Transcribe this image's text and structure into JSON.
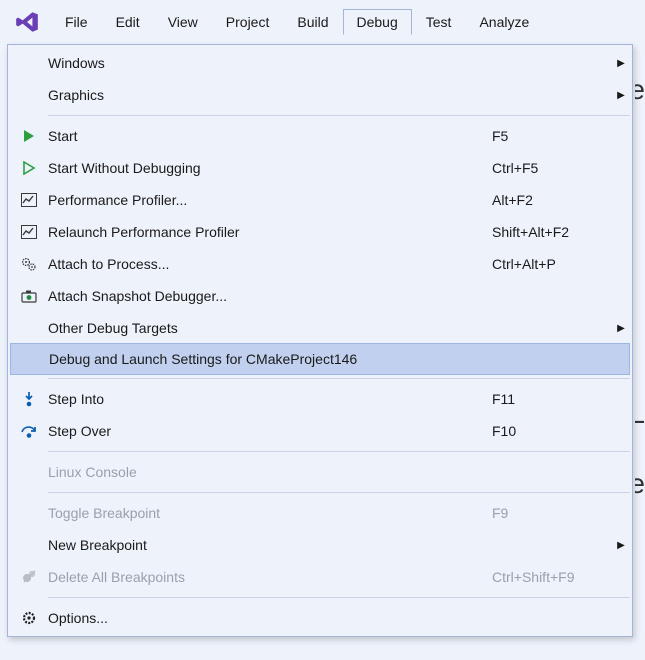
{
  "menubar": {
    "items": [
      {
        "label": "File"
      },
      {
        "label": "Edit"
      },
      {
        "label": "View"
      },
      {
        "label": "Project"
      },
      {
        "label": "Build"
      },
      {
        "label": "Debug"
      },
      {
        "label": "Test"
      },
      {
        "label": "Analyze"
      }
    ],
    "active_index": 5
  },
  "dropdown": {
    "items": [
      {
        "label": "Windows",
        "submenu": true
      },
      {
        "label": "Graphics",
        "submenu": true
      },
      {
        "sep": true
      },
      {
        "label": "Start",
        "shortcut": "F5",
        "icon": "play-green"
      },
      {
        "label": "Start Without Debugging",
        "shortcut": "Ctrl+F5",
        "icon": "play-outline"
      },
      {
        "label": "Performance Profiler...",
        "shortcut": "Alt+F2",
        "icon": "profiler"
      },
      {
        "label": "Relaunch Performance Profiler",
        "shortcut": "Shift+Alt+F2",
        "icon": "profiler"
      },
      {
        "label": "Attach to Process...",
        "shortcut": "Ctrl+Alt+P",
        "icon": "gears"
      },
      {
        "label": "Attach Snapshot Debugger...",
        "icon": "snapshot-camera"
      },
      {
        "label": "Other Debug Targets",
        "submenu": true
      },
      {
        "label": "Debug and Launch Settings for CMakeProject146",
        "highlight": true
      },
      {
        "sep": true
      },
      {
        "label": "Step Into",
        "shortcut": "F11",
        "icon": "step-into"
      },
      {
        "label": "Step Over",
        "shortcut": "F10",
        "icon": "step-over"
      },
      {
        "sep": true
      },
      {
        "label": "Linux Console",
        "disabled": true
      },
      {
        "sep": true
      },
      {
        "label": "Toggle Breakpoint",
        "shortcut": "F9",
        "disabled": true
      },
      {
        "label": "New Breakpoint",
        "submenu": true
      },
      {
        "label": "Delete All Breakpoints",
        "shortcut": "Ctrl+Shift+F9",
        "icon": "delete-bp",
        "disabled": true
      },
      {
        "sep": true
      },
      {
        "label": "Options...",
        "icon": "gear"
      }
    ]
  },
  "background_glyphs": {
    "g1": "e",
    "g2": "L",
    "g3": "e"
  }
}
